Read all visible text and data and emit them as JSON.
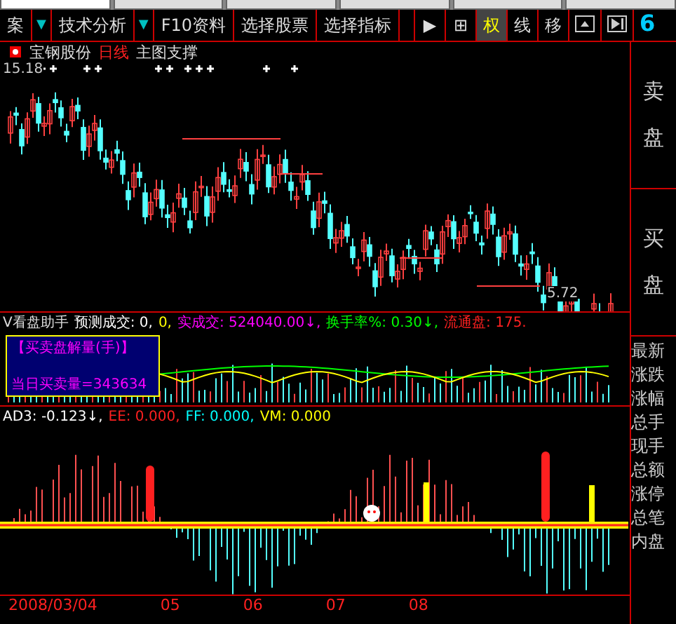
{
  "top_tabs": [
    {
      "selected": true
    },
    {
      "selected": false
    },
    {
      "selected": false
    },
    {
      "selected": false
    },
    {
      "selected": false
    },
    {
      "selected": false
    }
  ],
  "toolbar": {
    "menus": [
      {
        "kind": "text",
        "label": "案"
      },
      {
        "kind": "caret",
        "label": "▼"
      },
      {
        "kind": "text",
        "label": "技术分析"
      },
      {
        "kind": "caret",
        "label": "▼"
      },
      {
        "kind": "text",
        "label": "F10资料"
      },
      {
        "kind": "text",
        "label": "选择股票"
      },
      {
        "kind": "text",
        "label": "选择指标"
      }
    ],
    "tools": [
      {
        "kind": "text",
        "label": "▶",
        "selected": false
      },
      {
        "kind": "text",
        "label": "⊞",
        "selected": false
      },
      {
        "kind": "text",
        "label": "权",
        "selected": true
      },
      {
        "kind": "text",
        "label": "线",
        "selected": false
      },
      {
        "kind": "text",
        "label": "移",
        "selected": false
      },
      {
        "kind": "panel",
        "selected": false
      },
      {
        "kind": "skip",
        "selected": false
      }
    ],
    "edge_label": "6"
  },
  "chart_header": {
    "stock": "宝钢股份",
    "period": "日线",
    "chart": "主图支撑"
  },
  "price_labels": {
    "high": "15.18",
    "low": "5.72"
  },
  "volume_panel": {
    "title": "V看盘助手",
    "readouts": [
      {
        "text": "预测成交: 0,",
        "color": "#ffffff"
      },
      {
        "text": "0,",
        "color": "#ffff00"
      },
      {
        "text": "实成交: 524040.00↓,",
        "color": "#ff00ff"
      },
      {
        "text": "换手率%: 0.30↓,",
        "color": "#00ff00"
      },
      {
        "text": "流通盘: 175.",
        "color": "#ff2020"
      }
    ],
    "box": {
      "title": "【买卖盘解量(手)】",
      "text": "当日买卖量=343634"
    }
  },
  "indicator_panel": {
    "readouts": [
      {
        "text": "AD3: -0.123↓,",
        "color": "#ffffff"
      },
      {
        "text": "EE: 0.000,",
        "color": "#ff2020"
      },
      {
        "text": "FF: 0.000,",
        "color": "#00ffff"
      },
      {
        "text": "VM: 0.000",
        "color": "#ffff00"
      }
    ]
  },
  "date_axis": [
    "2008/03/04",
    "05",
    "06",
    "07",
    "08"
  ],
  "side_panel": {
    "sell": "卖盘",
    "buy": "买盘",
    "quote_labels": [
      "最新",
      "涨跌",
      "涨幅",
      "总手",
      "现手",
      "总额",
      "涨停",
      "总笔",
      "内盘"
    ]
  }
}
